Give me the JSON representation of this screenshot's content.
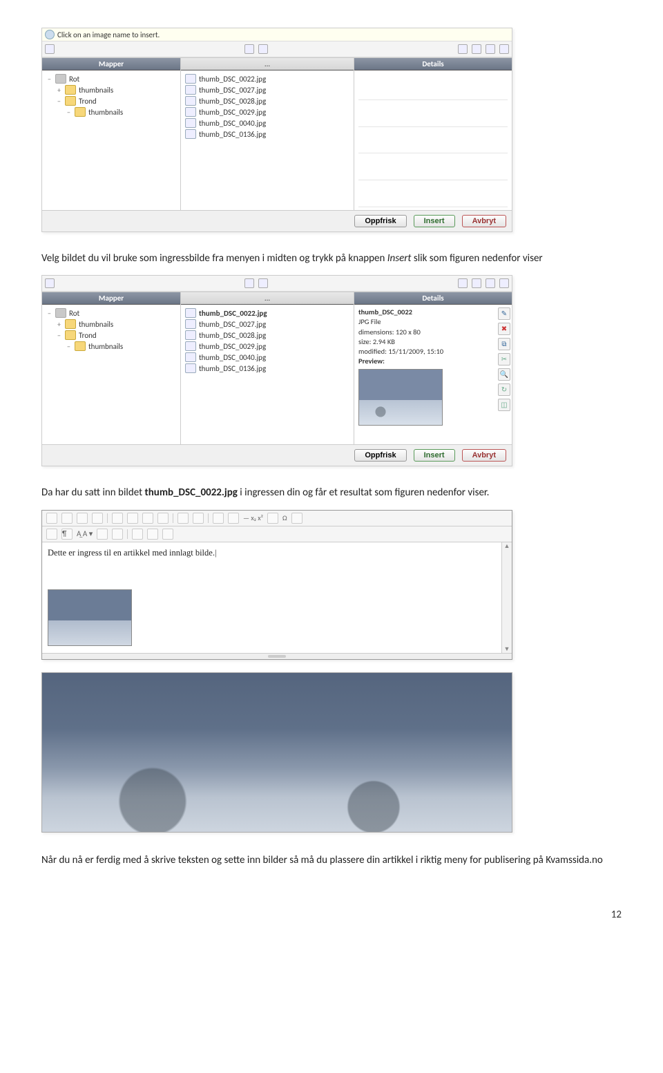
{
  "infoBar": {
    "text": "Click on an image name to insert."
  },
  "panel1": {
    "treeHeader": "Mapper",
    "filesHeader": "...",
    "detailsHeader": "Details",
    "tree": [
      {
        "label": "Rot",
        "twisty": "−",
        "icon": "folder-grey",
        "indent": 0
      },
      {
        "label": "thumbnails",
        "twisty": "+",
        "icon": "folder-yell",
        "indent": 1
      },
      {
        "label": "Trond",
        "twisty": "−",
        "icon": "folder-yell",
        "indent": 1
      },
      {
        "label": "thumbnails",
        "twisty": "−",
        "icon": "folder-yell",
        "indent": 2
      }
    ],
    "files": [
      "thumb_DSC_0022.jpg",
      "thumb_DSC_0027.jpg",
      "thumb_DSC_0028.jpg",
      "thumb_DSC_0029.jpg",
      "thumb_DSC_0040.jpg",
      "thumb_DSC_0136.jpg"
    ],
    "buttons": {
      "refresh": "Oppfrisk",
      "insert": "Insert",
      "cancel": "Avbryt"
    }
  },
  "para1a": "Velg bildet du vil bruke som ingressbilde fra menyen i midten og trykk på knappen ",
  "para1b": "Insert",
  "para1c": " slik som figuren nedenfor viser",
  "panel2": {
    "treeHeader": "Mapper",
    "filesHeader": "...",
    "detailsHeader": "Details",
    "tree": [
      {
        "label": "Rot",
        "twisty": "−",
        "icon": "folder-grey",
        "indent": 0
      },
      {
        "label": "thumbnails",
        "twisty": "+",
        "icon": "folder-yell",
        "indent": 1
      },
      {
        "label": "Trond",
        "twisty": "−",
        "icon": "folder-yell",
        "indent": 1
      },
      {
        "label": "thumbnails",
        "twisty": "−",
        "icon": "folder-yell",
        "indent": 2
      }
    ],
    "files": [
      "thumb_DSC_0022.jpg",
      "thumb_DSC_0027.jpg",
      "thumb_DSC_0028.jpg",
      "thumb_DSC_0029.jpg",
      "thumb_DSC_0040.jpg",
      "thumb_DSC_0136.jpg"
    ],
    "selectedFile": "thumb_DSC_0022.jpg",
    "details": {
      "title": "thumb_DSC_0022",
      "type": "JPG File",
      "dim": "dimensions: 120 x 80",
      "size": "size: 2.94 KB",
      "modified": "modified: 15/11/2009, 15:10",
      "preview": "Preview:"
    },
    "buttons": {
      "refresh": "Oppfrisk",
      "insert": "Insert",
      "cancel": "Avbryt"
    }
  },
  "para2a": "Da har du satt inn bildet ",
  "para2b": "thumb_DSC_0022.jpg",
  "para2c": " i ingressen din og får et resultat som figuren nedenfor viser.",
  "editor": {
    "text": "Dette er ingress til en artikkel med innlagt bilde."
  },
  "para3": "Når du nå er ferdig med å skrive teksten og sette inn bilder så må du plassere din artikkel i riktig meny for publisering på Kvamssida.no",
  "pageNum": "12"
}
